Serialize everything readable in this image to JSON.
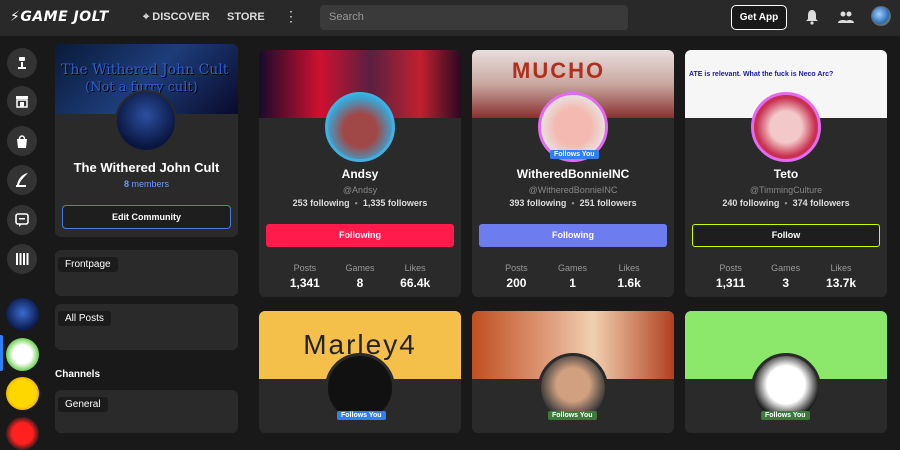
{
  "topbar": {
    "logo": "GAME JOLT",
    "discover": "DISCOVER",
    "store": "STORE",
    "more": "⋮",
    "search_placeholder": "Search",
    "get_app": "Get App"
  },
  "community": {
    "banner_line1": "The Withered John Cult",
    "banner_line2": "(Not a furry cult)",
    "title": "The Withered John Cult",
    "members_count": "8",
    "members_label": " members",
    "edit_label": "Edit Community"
  },
  "channels_nav": {
    "frontpage": "Frontpage",
    "all_posts": "All Posts",
    "channels_header": "Channels",
    "general": "General"
  },
  "users": [
    {
      "name": "Andsy",
      "handle": "@Andsy",
      "following": "253 following",
      "followers": "1,335 followers",
      "button": "Following",
      "button_color": "#ff1c4c",
      "follows_you": "",
      "posts_label": "Posts",
      "posts": "1,341",
      "games_label": "Games",
      "games": "8",
      "likes_label": "Likes",
      "likes": "66.4k"
    },
    {
      "name": "WitheredBonnieINC",
      "handle": "@WitheredBonnieINC",
      "following": "393 following",
      "followers": "251 followers",
      "button": "Following",
      "button_color": "#6d7df0",
      "follows_you": "Follows You",
      "banner_text": "MUCHO",
      "posts_label": "Posts",
      "posts": "200",
      "games_label": "Games",
      "games": "1",
      "likes_label": "Likes",
      "likes": "1.6k"
    },
    {
      "name": "Teto",
      "handle": "@TimmingCulture",
      "following": "240 following",
      "followers": "374 followers",
      "button": "Follow",
      "button_color": "#2a2a2a",
      "follows_you": "",
      "banner_text": "ATE is relevant. What the fuck is Neco Arc?",
      "posts_label": "Posts",
      "posts": "1,311",
      "games_label": "Games",
      "games": "3",
      "likes_label": "Likes",
      "likes": "13.7k"
    }
  ],
  "second_row": [
    {
      "banner_text": "Marley4",
      "follows_you": "Follows You"
    },
    {
      "banner_text": "",
      "follows_you": "Follows You"
    },
    {
      "banner_text": "",
      "follows_you": "Follows You"
    }
  ],
  "colors": {
    "accent_blue": "#2f7ff7",
    "accent_green": "#ccff00",
    "following_red": "#ff1c4c"
  }
}
